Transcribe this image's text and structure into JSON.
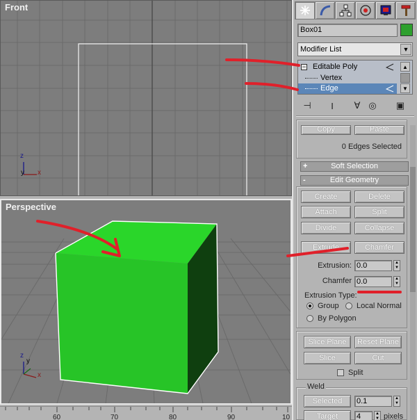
{
  "viewports": {
    "front_label": "Front",
    "perspective_label": "Perspective",
    "axis_z": "z",
    "axis_y": "y",
    "axis_x": "x"
  },
  "timeline": {
    "ticks": [
      "60",
      "70",
      "80",
      "90",
      "10"
    ]
  },
  "command_panel": {
    "tabs": [
      "create-icon",
      "modify-icon",
      "hierarchy-icon",
      "motion-icon",
      "display-icon",
      "utilities-icon"
    ],
    "object_name": "Box01",
    "object_color": "#2ea02e",
    "modifier_list": "Modifier List",
    "stack": {
      "items": [
        "Editable Poly",
        "Vertex",
        "Edge"
      ],
      "selected": "Edge"
    },
    "selection": {
      "copy_label": "Copy",
      "paste_label": "Paste",
      "status": "0 Edges Selected"
    },
    "soft_selection": {
      "title": "Soft Selection",
      "sign": "+"
    },
    "edit_geometry": {
      "title": "Edit Geometry",
      "sign": "-",
      "buttons": {
        "create": "Create",
        "delete": "Delete",
        "attach": "Attach",
        "split": "Split",
        "divide": "Divide",
        "collapse": "Collapse",
        "extrude": "Extrude",
        "chamfer": "Chamfer"
      },
      "extrusion_label": "Extrusion:",
      "extrusion_value": "0.0",
      "chamfer_label": "Chamfer",
      "chamfer_value": "0.0",
      "extrusion_type_label": "Extrusion Type:",
      "radio_group": "Group",
      "radio_local_normal": "Local Normal",
      "radio_by_polygon": "By Polygon",
      "slice_plane": "Slice Plane",
      "reset_plane": "Reset Plane",
      "slice": "Slice",
      "cut": "Cut",
      "split_check": "Split"
    },
    "weld": {
      "title": "Weld",
      "selected_label": "Selected",
      "selected_value": "0.1",
      "target_label": "Target",
      "target_value": "4",
      "pixels_label": "pixels"
    }
  },
  "colors": {
    "cube_front": "#27c427",
    "cube_top": "#2ad62a",
    "cube_side": "#0f3f0f",
    "annotation_red": "#e0202a",
    "selection_blue": "#5b86b8"
  }
}
